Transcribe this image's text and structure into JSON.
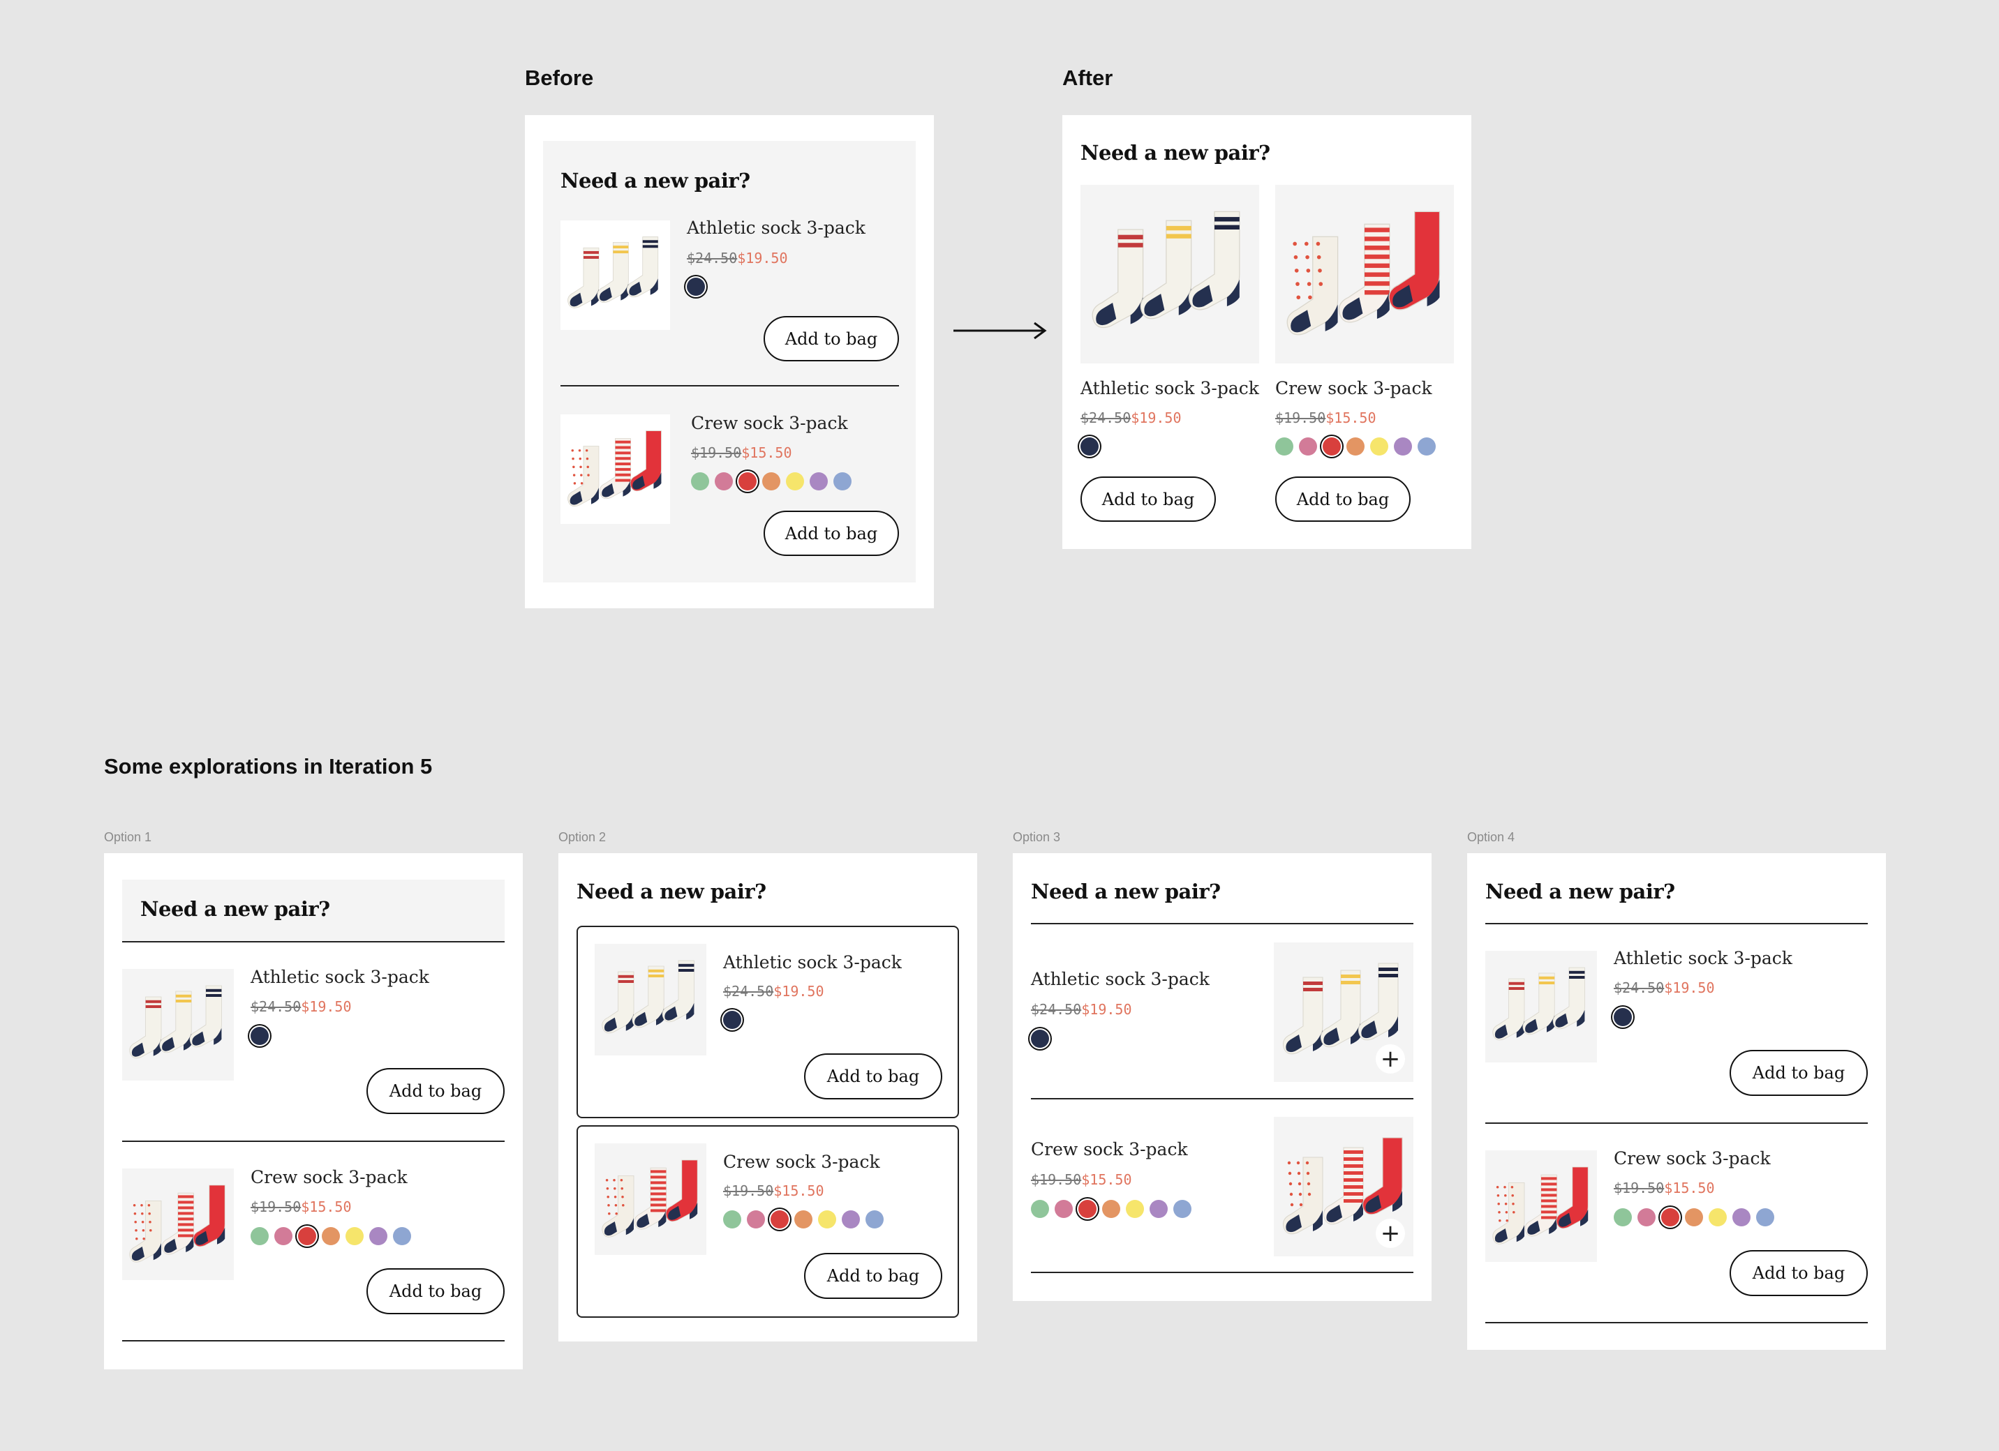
{
  "labels": {
    "before": "Before",
    "after": "After",
    "explorations": "Some explorations in Iteration 5",
    "option1": "Option 1",
    "option2": "Option 2",
    "option3": "Option 3",
    "option4": "Option 4"
  },
  "widget": {
    "heading": "Need a new pair?",
    "add_label": "Add to bag"
  },
  "products": {
    "athletic": {
      "name": "Athletic sock 3-pack",
      "old_price": "$24.50",
      "new_price": "$19.50",
      "colors": [
        "#26304d"
      ]
    },
    "crew": {
      "name": "Crew sock 3-pack",
      "old_price": "$19.50",
      "new_price": "$15.50",
      "colors": [
        "#8fc59a",
        "#d27b98",
        "#d8403d",
        "#e39563",
        "#f6e56b",
        "#a987c2",
        "#8ea6d2"
      ],
      "selected_color_index": 2
    }
  },
  "colors": {
    "page_bg": "#e6e6e6",
    "sale_price": "#e0745e",
    "panel_bg": "#f4f4f4"
  },
  "icons": {
    "arrow": "arrow-right-icon",
    "quick_add": "plus-icon"
  }
}
